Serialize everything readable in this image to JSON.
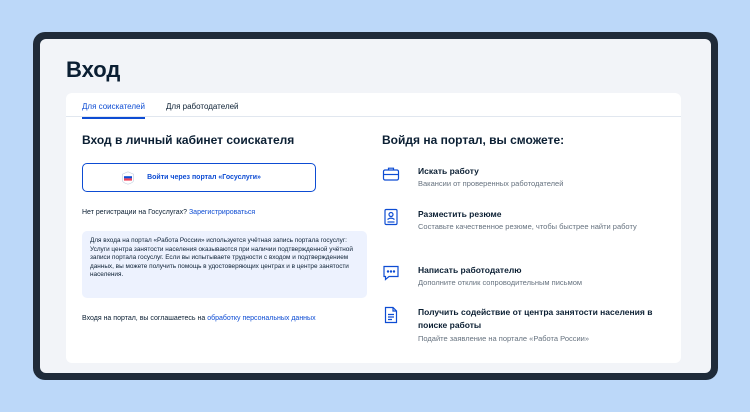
{
  "page": {
    "title": "Вход"
  },
  "tabs": [
    {
      "label": "Для соискателей",
      "active": true
    },
    {
      "label": "Для работодателей",
      "active": false
    }
  ],
  "login": {
    "heading": "Вход в личный кабинет соискателя",
    "gosuslugi_button": "Войти через портал «Госуслуги»",
    "no_registration": "Нет регистрации на Госуслугах?",
    "register_link": "Зарегистрироваться",
    "info": "Для входа на портал «Работа России» используется учётная запись портала госуслуг: Услуги центра занятости населения оказываются при наличии подтвержденной учётной записи портала госуслуг. Если вы испытываете трудности с входом и подтверждением данных, вы можете получить помощь в удостоверяющих центрах и в центре занятости населения.",
    "agree_text": "Входя на портал, вы соглашаетесь на",
    "agree_link": "обработку персональных данных"
  },
  "features": {
    "heading": "Войдя на портал, вы сможете:",
    "items": [
      {
        "icon": "briefcase-icon",
        "title": "Искать работу",
        "desc": "Вакансии от проверенных работодателей"
      },
      {
        "icon": "resume-icon",
        "title": "Разместить резюме",
        "desc": "Составьте качественное резюме, чтобы быстрее найти работу"
      },
      {
        "icon": "message-icon",
        "title": "Написать работодателю",
        "desc": "Дополните отклик сопроводительным письмом"
      },
      {
        "icon": "document-icon",
        "title": "Получить содействие от центра занятости населения в поиске работы",
        "desc": "Подайте заявление на портале «Работа России»"
      }
    ]
  },
  "colors": {
    "accent": "#0d4cd3",
    "background": "#bcd8f9",
    "frame": "#1f2b3a",
    "info_bg": "#edf2fe"
  }
}
